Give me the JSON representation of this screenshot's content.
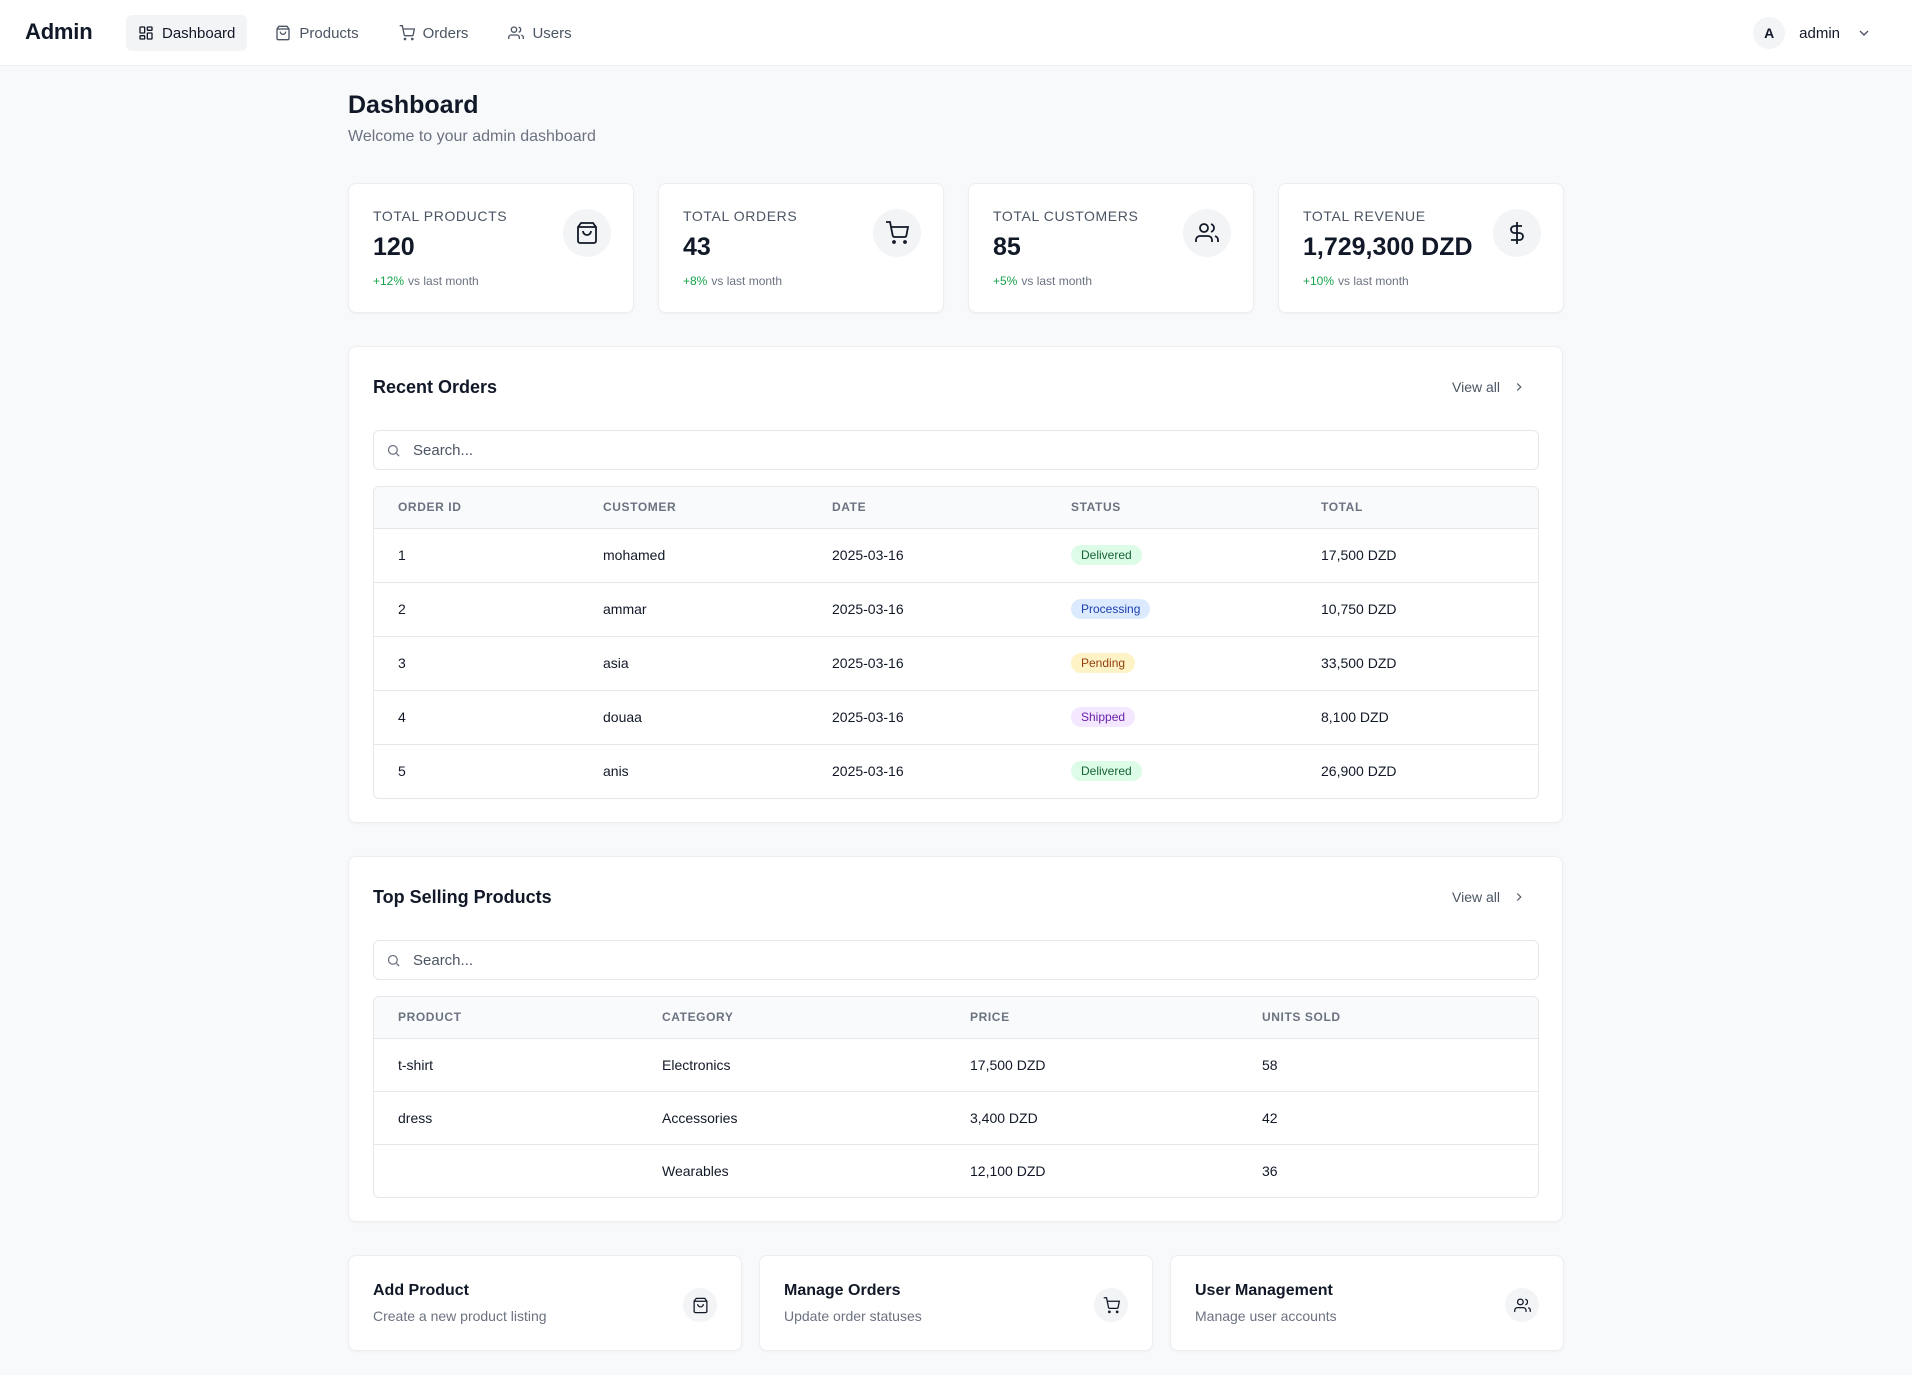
{
  "app": {
    "brand": "Admin"
  },
  "nav": {
    "items": [
      {
        "label": "Dashboard",
        "icon": "dashboard-icon",
        "active": true
      },
      {
        "label": "Products",
        "icon": "bag-icon",
        "active": false
      },
      {
        "label": "Orders",
        "icon": "cart-icon",
        "active": false
      },
      {
        "label": "Users",
        "icon": "users-icon",
        "active": false
      }
    ]
  },
  "user": {
    "initial": "A",
    "name": "admin"
  },
  "page": {
    "title": "Dashboard",
    "subtitle": "Welcome to your admin dashboard"
  },
  "stats": [
    {
      "label": "Total Products",
      "value": "120",
      "delta": "+12%",
      "delta_suffix": "vs last month",
      "icon": "bag-icon"
    },
    {
      "label": "Total Orders",
      "value": "43",
      "delta": "+8%",
      "delta_suffix": "vs last month",
      "icon": "cart-icon"
    },
    {
      "label": "Total Customers",
      "value": "85",
      "delta": "+5%",
      "delta_suffix": "vs last month",
      "icon": "users-icon"
    },
    {
      "label": "Total Revenue",
      "value": "1,729,300 DZD",
      "delta": "+10%",
      "delta_suffix": "vs last month",
      "icon": "dollar-icon"
    }
  ],
  "recent_orders": {
    "title": "Recent Orders",
    "view_all": "View all",
    "search_placeholder": "Search...",
    "columns": [
      "Order ID",
      "Customer",
      "Date",
      "Status",
      "Total"
    ],
    "rows": [
      {
        "id": "1",
        "customer": "mohamed",
        "date": "2025-03-16",
        "status": "Delivered",
        "total": "17,500 DZD"
      },
      {
        "id": "2",
        "customer": "ammar",
        "date": "2025-03-16",
        "status": "Processing",
        "total": "10,750 DZD"
      },
      {
        "id": "3",
        "customer": "asia",
        "date": "2025-03-16",
        "status": "Pending",
        "total": "33,500 DZD"
      },
      {
        "id": "4",
        "customer": "douaa",
        "date": "2025-03-16",
        "status": "Shipped",
        "total": "8,100 DZD"
      },
      {
        "id": "5",
        "customer": "anis",
        "date": "2025-03-16",
        "status": "Delivered",
        "total": "26,900 DZD"
      }
    ]
  },
  "top_products": {
    "title": "Top Selling Products",
    "view_all": "View all",
    "search_placeholder": "Search...",
    "columns": [
      "Product",
      "Category",
      "Price",
      "Units Sold"
    ],
    "rows": [
      {
        "product": "t-shirt",
        "category": "Electronics",
        "price": "17,500 DZD",
        "units": "58"
      },
      {
        "product": "dress",
        "category": "Accessories",
        "price": "3,400 DZD",
        "units": "42"
      },
      {
        "product": "",
        "category": "Wearables",
        "price": "12,100 DZD",
        "units": "36"
      }
    ]
  },
  "quick_actions": [
    {
      "title": "Add Product",
      "desc": "Create a new product listing",
      "icon": "bag-icon"
    },
    {
      "title": "Manage Orders",
      "desc": "Update order statuses",
      "icon": "cart-icon"
    },
    {
      "title": "User Management",
      "desc": "Manage user accounts",
      "icon": "users-icon"
    }
  ],
  "colors": {
    "background": "#f8f9fb",
    "positive": "#16a34a",
    "delivered": "#dcfce7",
    "processing": "#dbeafe",
    "pending": "#fef3c7",
    "shipped": "#f3e8ff"
  }
}
